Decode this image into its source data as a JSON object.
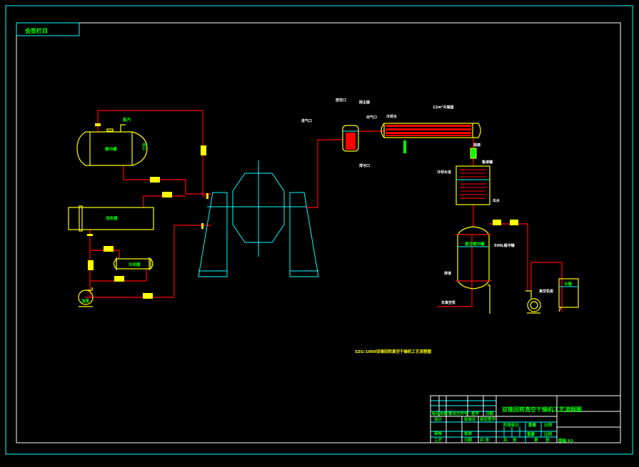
{
  "drawing": {
    "corner_stamp": "会签栏目",
    "caption": "SZG-1000双锥回转真空干燥机工艺流程图",
    "colors": {
      "background": "#000000",
      "frame": "#ffffff",
      "border": "#00ffff",
      "equipment": "#ffff00",
      "pipe": "#ff0000",
      "text": "#00ff00"
    }
  },
  "equipment_labels": {
    "buffer_tank": "缓冲罐",
    "steam": "蒸汽",
    "heater": "加热器",
    "cooler": "冷却器",
    "oil_pump": "油泵",
    "filter_in": "进气口",
    "filter": "除尘器",
    "filter_top": "放空口",
    "filter_out": "出气口",
    "filter_bottom": "排污口",
    "condenser": "12m²冷凝器",
    "condenser_water": "冷却水",
    "sight": "视镜",
    "receiver": "集液罐",
    "receiver_in": "冷却水进",
    "receiver_out": "出水",
    "vacuum_tank": "500L缓冲罐",
    "vacuum_tank_tag": "真空缓冲罐",
    "drain": "排液",
    "vacuum_pump_in": "去真空泵",
    "vacuum_pump": "真空机组",
    "water_tank": "水箱",
    "outlet": "出口"
  },
  "title_block": {
    "title": "双锥回转真空干燥机工艺流程图",
    "rows": [
      [
        "标记",
        "处数",
        "更改文件号",
        "签字",
        "日期"
      ],
      [
        "设计",
        "",
        "标准化",
        "审定签字"
      ],
      [
        "审核",
        "",
        "批准",
        ""
      ],
      [
        "工艺",
        "",
        "日期",
        "共 张"
      ]
    ],
    "stage_label": "阶段标记",
    "weight_label": "重量",
    "scale_label": "比例",
    "weight_value": "重量",
    "scale_value": "比例",
    "sheet_total": "共",
    "sheet_unit": "张",
    "sheet_no": "第",
    "sheet_no_unit": "张",
    "format": "图幅 A3"
  }
}
